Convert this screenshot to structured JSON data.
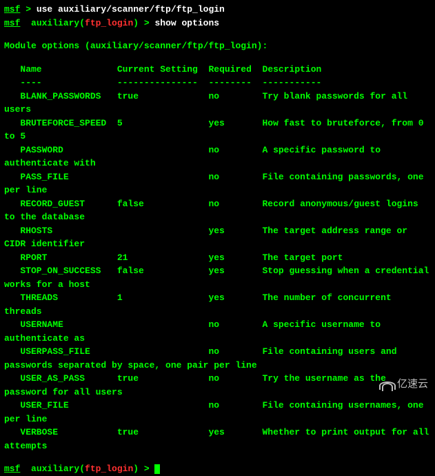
{
  "prompt1": {
    "msf": "msf",
    "arrow": " > ",
    "command": "use auxiliary/scanner/ftp/ftp_login"
  },
  "prompt2": {
    "msf": "msf",
    "space": "  ",
    "auxiliary": "auxiliary(",
    "module": "ftp_login",
    "close": ") > ",
    "command": "show options"
  },
  "module_header": "Module options (auxiliary/scanner/ftp/ftp_login):",
  "headers": {
    "name": "Name",
    "current": "Current Setting",
    "required": "Required",
    "description": "Description"
  },
  "dashes": {
    "name": "----",
    "current": "---------------",
    "required": "--------",
    "description": "-----------"
  },
  "options": [
    {
      "name": "BLANK_PASSWORDS",
      "current": "true",
      "required": "no",
      "desc": "Try blank passwords for all users"
    },
    {
      "name": "BRUTEFORCE_SPEED",
      "current": "5",
      "required": "yes",
      "desc": "How fast to bruteforce, from 0 to 5"
    },
    {
      "name": "PASSWORD",
      "current": "",
      "required": "no",
      "desc": "A specific password to authenticate with"
    },
    {
      "name": "PASS_FILE",
      "current": "",
      "required": "no",
      "desc": "File containing passwords, one per line"
    },
    {
      "name": "RECORD_GUEST",
      "current": "false",
      "required": "no",
      "desc": "Record anonymous/guest logins to the database"
    },
    {
      "name": "RHOSTS",
      "current": "",
      "required": "yes",
      "desc": "The target address range or CIDR identifier"
    },
    {
      "name": "RPORT",
      "current": "21",
      "required": "yes",
      "desc": "The target port"
    },
    {
      "name": "STOP_ON_SUCCESS",
      "current": "false",
      "required": "yes",
      "desc": "Stop guessing when a credential works for a host"
    },
    {
      "name": "THREADS",
      "current": "1",
      "required": "yes",
      "desc": "The number of concurrent threads"
    },
    {
      "name": "USERNAME",
      "current": "",
      "required": "no",
      "desc": "A specific username to authenticate as"
    },
    {
      "name": "USERPASS_FILE",
      "current": "",
      "required": "no",
      "desc": "File containing users and passwords separated by space, one pair per line"
    },
    {
      "name": "USER_AS_PASS",
      "current": "true",
      "required": "no",
      "desc": "Try the username as the password for all users"
    },
    {
      "name": "USER_FILE",
      "current": "",
      "required": "no",
      "desc": "File containing usernames, one per line"
    },
    {
      "name": "VERBOSE",
      "current": "true",
      "required": "yes",
      "desc": "Whether to print output for all attempts"
    }
  ],
  "prompt3": {
    "msf": "msf",
    "space": "  ",
    "auxiliary": "auxiliary(",
    "module": "ftp_login",
    "close": ") > "
  },
  "watermark": "亿速云"
}
